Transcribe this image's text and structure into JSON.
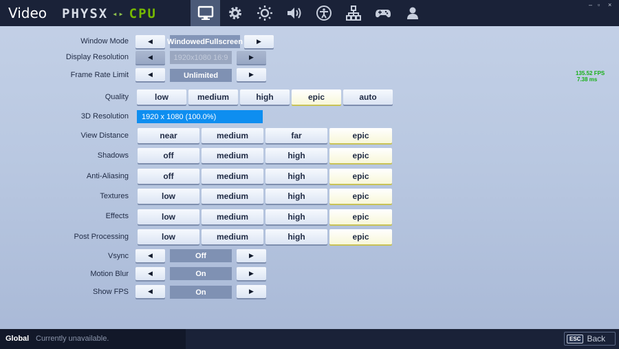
{
  "header": {
    "title": "Video",
    "brand_left": "PHYSX",
    "brand_sep": "◂▸",
    "brand_right": "CPU",
    "tabs": [
      {
        "name": "display-icon",
        "active": true
      },
      {
        "name": "gear-icon",
        "active": false
      },
      {
        "name": "brightness-icon",
        "active": false
      },
      {
        "name": "volume-icon",
        "active": false
      },
      {
        "name": "accessibility-icon",
        "active": false
      },
      {
        "name": "network-icon",
        "active": false
      },
      {
        "name": "gamepad-icon",
        "active": false
      },
      {
        "name": "account-icon",
        "active": false
      }
    ],
    "window_controls": [
      "–",
      "▫",
      "×"
    ]
  },
  "arrows": {
    "left": "◀",
    "right": "▶"
  },
  "settings": {
    "window_mode": {
      "label": "Window Mode",
      "value": "WindowedFullscreen"
    },
    "display_resolution": {
      "label": "Display Resolution",
      "value": "1920x1080 16:9"
    },
    "frame_rate_limit": {
      "label": "Frame Rate Limit",
      "value": "Unlimited"
    },
    "quality": {
      "label": "Quality",
      "options": [
        "low",
        "medium",
        "high",
        "epic",
        "auto"
      ],
      "selected": "epic"
    },
    "resolution_3d": {
      "label": "3D Resolution",
      "value": "1920 x 1080 (100.0%)",
      "percent": 100
    },
    "view_distance": {
      "label": "View Distance",
      "options": [
        "near",
        "medium",
        "far",
        "epic"
      ],
      "selected": "epic"
    },
    "shadows": {
      "label": "Shadows",
      "options": [
        "off",
        "medium",
        "high",
        "epic"
      ],
      "selected": "epic"
    },
    "anti_aliasing": {
      "label": "Anti-Aliasing",
      "options": [
        "off",
        "medium",
        "high",
        "epic"
      ],
      "selected": "epic"
    },
    "textures": {
      "label": "Textures",
      "options": [
        "low",
        "medium",
        "high",
        "epic"
      ],
      "selected": "epic"
    },
    "effects": {
      "label": "Effects",
      "options": [
        "low",
        "medium",
        "high",
        "epic"
      ],
      "selected": "epic"
    },
    "post_processing": {
      "label": "Post Processing",
      "options": [
        "low",
        "medium",
        "high",
        "epic"
      ],
      "selected": "epic"
    },
    "vsync": {
      "label": "Vsync",
      "value": "Off"
    },
    "motion_blur": {
      "label": "Motion Blur",
      "value": "On"
    },
    "show_fps": {
      "label": "Show FPS",
      "value": "On"
    }
  },
  "fps_overlay": {
    "fps": "135.52 FPS",
    "ms": "7.38 ms"
  },
  "footer": {
    "scope": "Global",
    "status": "Currently unavailable.",
    "esc_key": "ESC",
    "back_label": "Back"
  },
  "colors": {
    "bar_bg": "#1a2238",
    "accent_blue": "#0e8ef0",
    "selected_option": "#f8f7d8",
    "fps_green": "#18b018",
    "brand_green": "#76b900"
  }
}
